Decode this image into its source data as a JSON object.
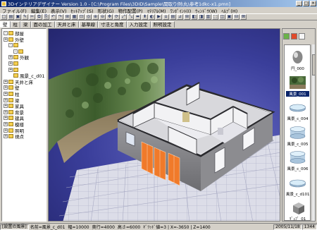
{
  "window": {
    "title": "3Dインテリアデザイナー Version 1.0 - [C:\\Program Files\\3DID\\Sample\\関取り例\\丸\\参考1dkc-x1.pmn]",
    "minimize_glyph": "_",
    "maximize_glyph": "□",
    "close_glyph": "×"
  },
  "menu": [
    "ファイル(F)",
    "編集(E)",
    "表示(V)",
    "ｾｯﾄｱｯﾌﾟ(S)",
    "形状(G)",
    "物作配置(P)",
    "ﾏﾃﾘｱﾙ(M)",
    "ﾜﾝﾎﾟｲﾝﾄ(I)",
    "ｳｨﾝﾄﾞｳ(W)",
    "ﾍﾙﾌﾟ(H)"
  ],
  "toolbar_glyphs": [
    "□",
    "▤",
    "▣",
    "✎",
    "✂",
    "⧉",
    "⎘",
    "↶",
    "↷",
    "⊞",
    "▦",
    "⊡",
    "◎",
    "⊕",
    "⊖",
    "✥",
    "⟳",
    "⤢",
    "⤡",
    "⬌",
    "⬍",
    "◐",
    "▶",
    "⌂",
    "▤",
    "⊿",
    "⊞",
    "◧",
    "◨",
    "▥",
    "⬚",
    "◫",
    "▣",
    "⊟",
    "⊠"
  ],
  "tabs": [
    "壁",
    "柱",
    "梁",
    "面の加工",
    "天井と床",
    "基準線",
    "寸法と角度",
    "入力設定",
    "照明設定"
  ],
  "active_tab": "壁",
  "tree": [
    {
      "label": "部屋",
      "expander": "-",
      "level": 0
    },
    {
      "label": "外壁",
      "expander": "+",
      "level": 0
    },
    {
      "label": "",
      "expander": "-",
      "level": 1
    },
    {
      "label": "",
      "expander": "-",
      "level": 2
    },
    {
      "label": "外観",
      "expander": "+",
      "level": 1
    },
    {
      "label": "",
      "expander": "+",
      "level": 1
    },
    {
      "label": "",
      "expander": "+",
      "level": 1
    },
    {
      "label": "風景_c_d01",
      "expander": "",
      "level": 2
    },
    {
      "label": "天井と床",
      "expander": "+",
      "level": 0
    },
    {
      "label": "壁",
      "expander": "+",
      "level": 0
    },
    {
      "label": "柱",
      "expander": "+",
      "level": 0
    },
    {
      "label": "梁",
      "expander": "+",
      "level": 0
    },
    {
      "label": "家具",
      "expander": "+",
      "level": 0
    },
    {
      "label": "背景",
      "expander": "+",
      "level": 0
    },
    {
      "label": "建具",
      "expander": "+",
      "level": 0
    },
    {
      "label": "模様",
      "expander": "+",
      "level": 0
    },
    {
      "label": "照明",
      "expander": "+",
      "level": 0
    },
    {
      "label": "視点",
      "expander": "+",
      "level": 0
    }
  ],
  "library": [
    {
      "label": "円_000",
      "kind": "egg",
      "selected": false
    },
    {
      "label": "風景_001",
      "kind": "landscape",
      "selected": true
    },
    {
      "label": "風景_c_004",
      "kind": "disc",
      "selected": false
    },
    {
      "label": "風景_c_005",
      "kind": "disc-tall",
      "selected": false
    },
    {
      "label": "風景_c_006",
      "kind": "disc-tall",
      "selected": false
    },
    {
      "label": "風景_c_d101",
      "kind": "disc",
      "selected": false
    },
    {
      "label": "ｷﾞｭﾌﾞ_01",
      "kind": "cube",
      "selected": false
    }
  ],
  "status": {
    "mode": "[設置の風景]",
    "name": "名前=風景_c_d01",
    "width": "幅=10000",
    "depth": "奥行=4000",
    "height": "高さ=6000",
    "extra": "ｷﾞﾘｯﾄﾞ値=3 | X=-3650 | Z=1400",
    "date": "2005/11/18",
    "num": "1344"
  },
  "colors": {
    "viewport_bg": "#3a3e9a",
    "floor": "#dcdde8",
    "accent_selection": "#0a246a",
    "door_orange": "#f07a2a"
  }
}
